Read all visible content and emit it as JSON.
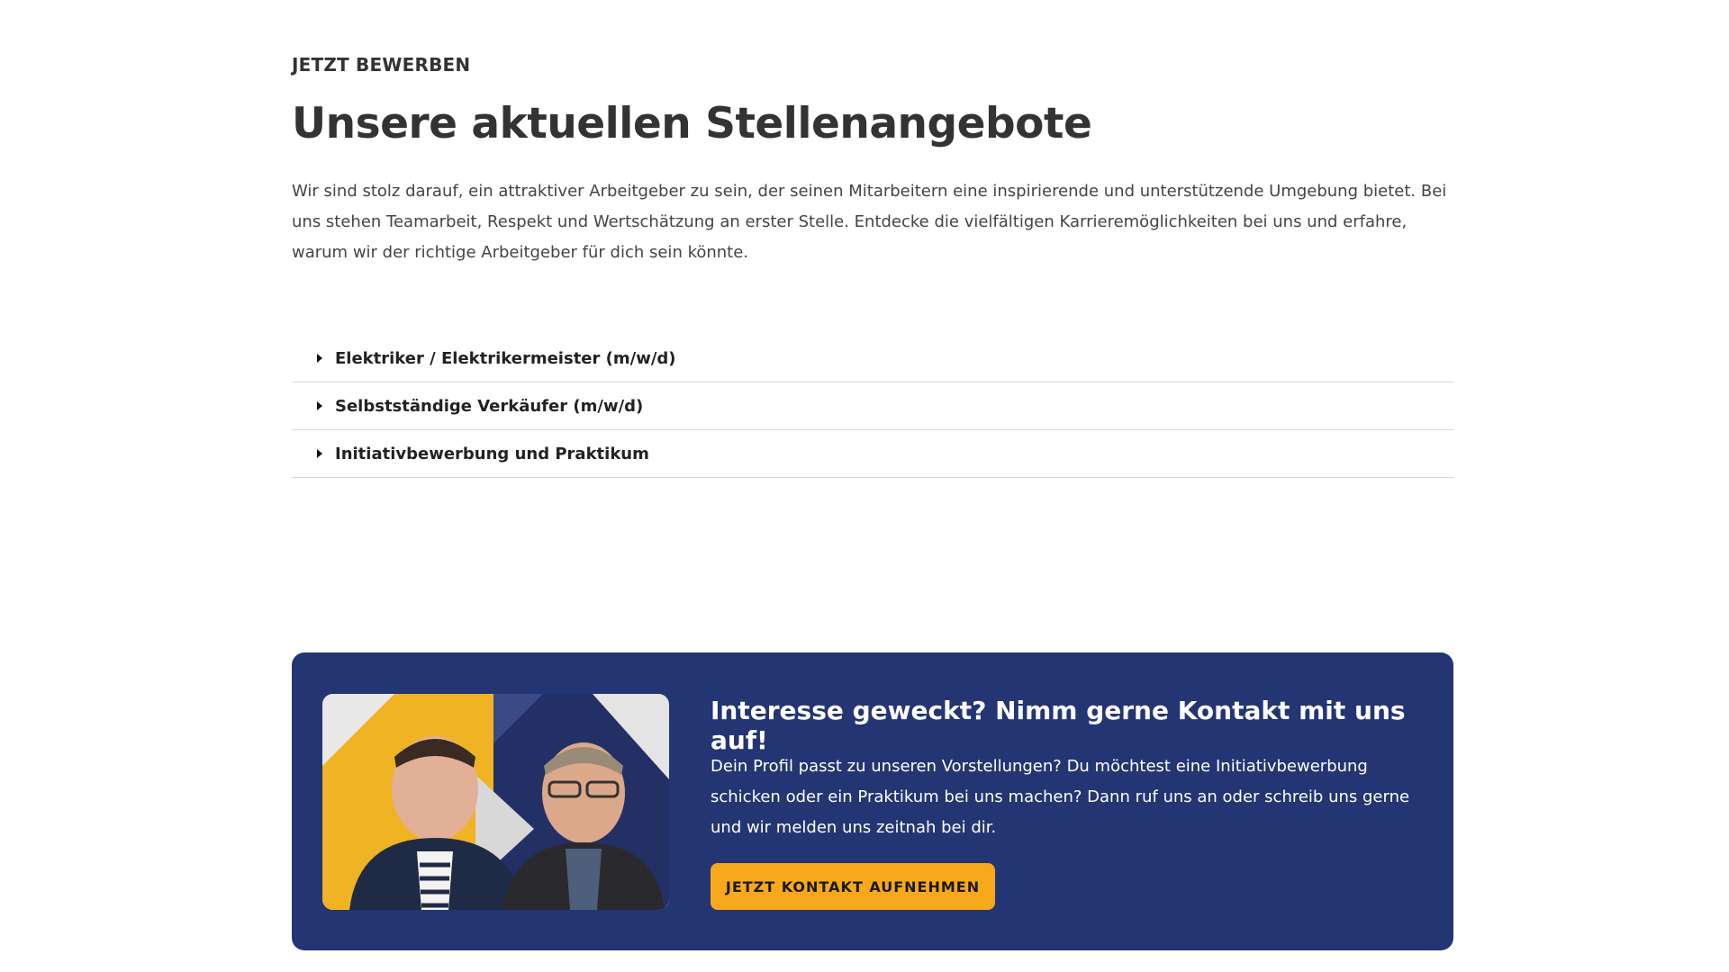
{
  "header": {
    "eyebrow": "JETZT BEWERBEN",
    "title": "Unsere aktuellen Stellenangebote",
    "intro": "Wir sind stolz darauf, ein attraktiver Arbeitgeber zu sein, der seinen Mitarbeitern eine inspirierende und unterstützende Umgebung bietet. Bei uns stehen Teamarbeit, Respekt und Wertschätzung an erster Stelle. Entdecke die vielfältigen Karrieremöglichkeiten bei uns und erfahre, warum wir der richtige Arbeitgeber für dich sein könnte."
  },
  "jobs": {
    "items": [
      {
        "label": "Elektriker / Elektrikermeister (m/w/d)",
        "icon": "caret-right-icon"
      },
      {
        "label": "Selbstständige Verkäufer (m/w/d)",
        "icon": "caret-right-icon"
      },
      {
        "label": "Initiativbewerbung und Praktikum",
        "icon": "caret-right-icon"
      }
    ]
  },
  "cta": {
    "title": "Interesse geweckt? Nimm gerne Kontakt mit uns auf!",
    "text": "Dein Profil passt zu unseren Vorstellungen? Du möchtest eine Initiativbewerbung schicken oder ein Praktikum bei uns machen? Dann ruf uns an oder schreib uns gerne und wir melden uns zeitnah bei dir.",
    "button_label": "JETZT KONTAKT AUFNEHMEN"
  },
  "colors": {
    "accent": "#f7a81b",
    "card_background": "#243573",
    "text": "#333333"
  }
}
